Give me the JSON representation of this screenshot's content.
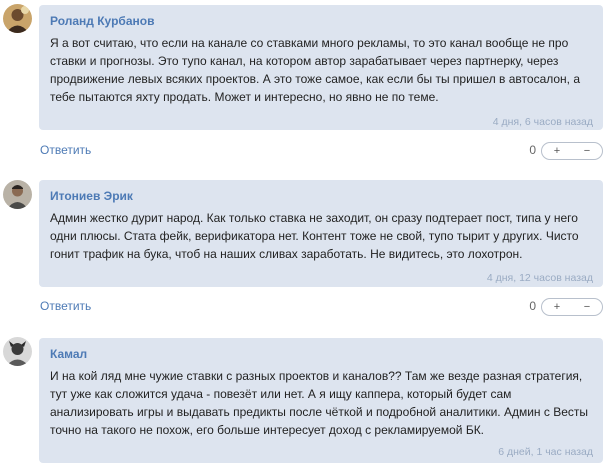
{
  "comments": [
    {
      "author": "Роланд Курбанов",
      "text": "Я а вот считаю, что если на канале со ставками много рекламы, то это канал вообще не про ставки и прогнозы. Это тупо канал, на котором автор зарабатывает через партнерку, через продвижение левых всяких проектов. А это тоже самое, как если бы ты пришел в автосалон, а тебе пытаются яхту продать. Может и интересно, но явно не по теме.",
      "time": "4 дня, 6 часов назад",
      "reply": "Ответить",
      "score": "0",
      "plus": "+",
      "minus": "−"
    },
    {
      "author": "Итониев Эрик",
      "text": "Админ жестко дурит народ. Как только ставка не заходит, он сразу подтерает пост, типа у него одни плюсы. Стата фейк, верификатора нет. Контент тоже не свой, тупо тырит у других. Чисто гонит трафик на бука, чтоб на наших сливах заработать. Не видитесь, это лохотрон.",
      "time": "4 дня, 12 часов назад",
      "reply": "Ответить",
      "score": "0",
      "plus": "+",
      "minus": "−"
    },
    {
      "author": "Камал",
      "text": "И на кой ляд мне чужие ставки с разных проектов и каналов?? Там же везде разная стратегия, тут уже как сложится удача - повезёт или нет. А я ищу каппера, который будет сам анализировать игры и выдавать предикты после чёткой и подробной аналитики. Админ с Весты точно на такого не похож, его больше интересует доход с рекламируемой БК.",
      "time": "6 дней, 1 час назад"
    }
  ]
}
